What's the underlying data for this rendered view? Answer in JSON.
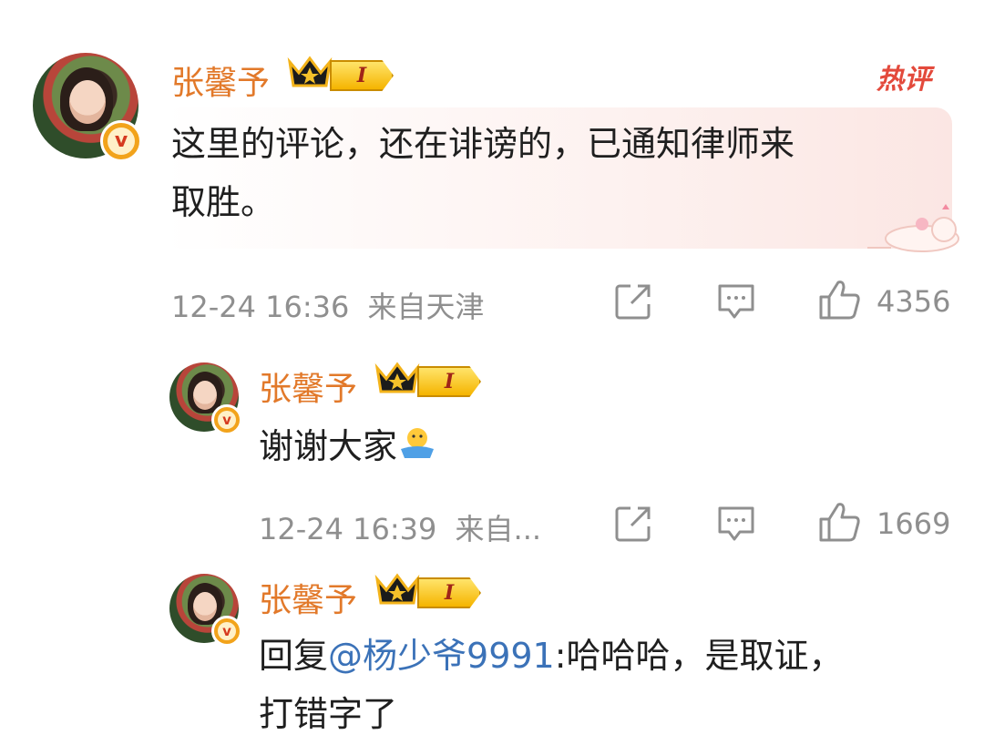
{
  "comments": [
    {
      "username": "张馨予",
      "level": "I",
      "hot_tag": "热评",
      "content": "这里的评论，还在诽谤的，已通知律师来取胜。",
      "content_line1": "这里的评论，还在诽谤的，已通知律师来",
      "content_line2": "取胜。",
      "time": "12-24 16:36",
      "location": "来自天津",
      "likes": "4356"
    },
    {
      "username": "张馨予",
      "level": "I",
      "content": "谢谢大家",
      "emoji": "😀",
      "time": "12-24 16:39",
      "location": "来自...",
      "likes": "1669"
    },
    {
      "username": "张馨予",
      "level": "I",
      "reply_prefix": "回复",
      "mention": "@杨少爷9991",
      "content_line1_rest": ":哈哈哈，是取证，",
      "content_line2": "打错字了"
    }
  ],
  "icons": {
    "share": "share-icon",
    "comment": "comment-icon",
    "like": "thumbs-up-icon",
    "verified": "verified-v-icon",
    "crown": "crown-icon"
  },
  "colors": {
    "username": "#e2792a",
    "mention": "#3b72b8",
    "meta": "#8f8f8f",
    "hot": "#e34a3c"
  }
}
